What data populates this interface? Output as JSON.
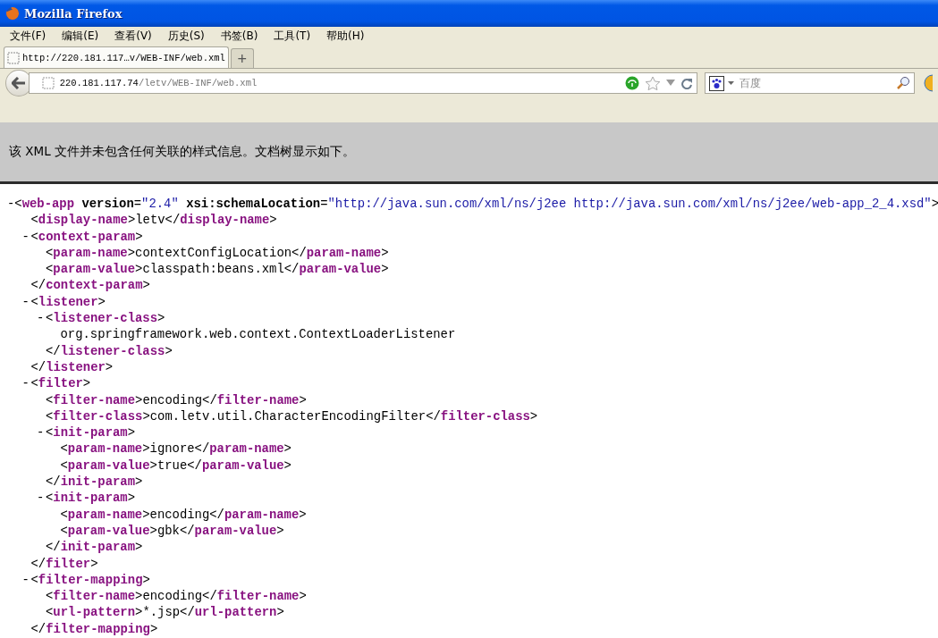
{
  "window": {
    "title": "Mozilla Firefox"
  },
  "menu": [
    "文件(F)",
    "编辑(E)",
    "查看(V)",
    "历史(S)",
    "书签(B)",
    "工具(T)",
    "帮助(H)"
  ],
  "tabs": [
    {
      "label": "http://220.181.117…v/WEB-INF/web.xml",
      "selected": true
    }
  ],
  "new_tab": "+",
  "address": {
    "host": "220.181.117.74",
    "path": "/letv/WEB-INF/web.xml"
  },
  "search": {
    "placeholder": "百度"
  },
  "info_bar": "该 XML 文件并未包含任何关联的样式信息。文档树显示如下。",
  "syntax": {
    "open": "<",
    "close": ">",
    "end_open": "</",
    "eq": "="
  },
  "tree": {
    "kind": "block",
    "toggle": "-",
    "expanded": true,
    "tag": "web-app",
    "attrs": [
      {
        "name": "version",
        "value": "\"2.4\""
      },
      {
        "name": "xsi:schemaLocation",
        "value": "\"http://java.sun.com/xml/ns/j2ee http://java.sun.com/xml/ns/j2ee/web-app_2_4.xsd\""
      }
    ],
    "children": [
      {
        "kind": "leaf",
        "tag": "display-name",
        "text": "letv",
        "end_tag": "display-name"
      },
      {
        "kind": "block",
        "toggle": "-",
        "expanded": true,
        "tag": "context-param",
        "end_tag": "context-param",
        "children": [
          {
            "kind": "leaf",
            "tag": "param-name",
            "text": "contextConfigLocation",
            "end_tag": "param-name"
          },
          {
            "kind": "leaf",
            "tag": "param-value",
            "text": "classpath:beans.xml",
            "end_tag": "param-value"
          }
        ]
      },
      {
        "kind": "block",
        "toggle": "-",
        "expanded": true,
        "tag": "listener",
        "end_tag": "listener",
        "children": [
          {
            "kind": "block",
            "toggle": "-",
            "expanded": true,
            "tag": "listener-class",
            "end_tag": "listener-class",
            "children": [
              {
                "kind": "text",
                "text": "org.springframework.web.context.ContextLoaderListener"
              }
            ]
          }
        ]
      },
      {
        "kind": "block",
        "toggle": "-",
        "expanded": true,
        "tag": "filter",
        "end_tag": "filter",
        "children": [
          {
            "kind": "leaf",
            "tag": "filter-name",
            "text": "encoding",
            "end_tag": "filter-name"
          },
          {
            "kind": "leaf",
            "tag": "filter-class",
            "text": "com.letv.util.CharacterEncodingFilter",
            "end_tag": "filter-class"
          },
          {
            "kind": "block",
            "toggle": "-",
            "expanded": true,
            "tag": "init-param",
            "end_tag": "init-param",
            "children": [
              {
                "kind": "leaf",
                "tag": "param-name",
                "text": "ignore",
                "end_tag": "param-name"
              },
              {
                "kind": "leaf",
                "tag": "param-value",
                "text": "true",
                "end_tag": "param-value"
              }
            ]
          },
          {
            "kind": "block",
            "toggle": "-",
            "expanded": true,
            "tag": "init-param",
            "end_tag": "init-param",
            "children": [
              {
                "kind": "leaf",
                "tag": "param-name",
                "text": "encoding",
                "end_tag": "param-name"
              },
              {
                "kind": "leaf",
                "tag": "param-value",
                "text": "gbk",
                "end_tag": "param-value"
              }
            ]
          }
        ]
      },
      {
        "kind": "block",
        "toggle": "-",
        "expanded": true,
        "tag": "filter-mapping",
        "end_tag": "filter-mapping",
        "children": [
          {
            "kind": "leaf",
            "tag": "filter-name",
            "text": "encoding",
            "end_tag": "filter-name"
          },
          {
            "kind": "leaf",
            "tag": "url-pattern",
            "text": "*.jsp",
            "end_tag": "url-pattern"
          }
        ]
      }
    ]
  }
}
